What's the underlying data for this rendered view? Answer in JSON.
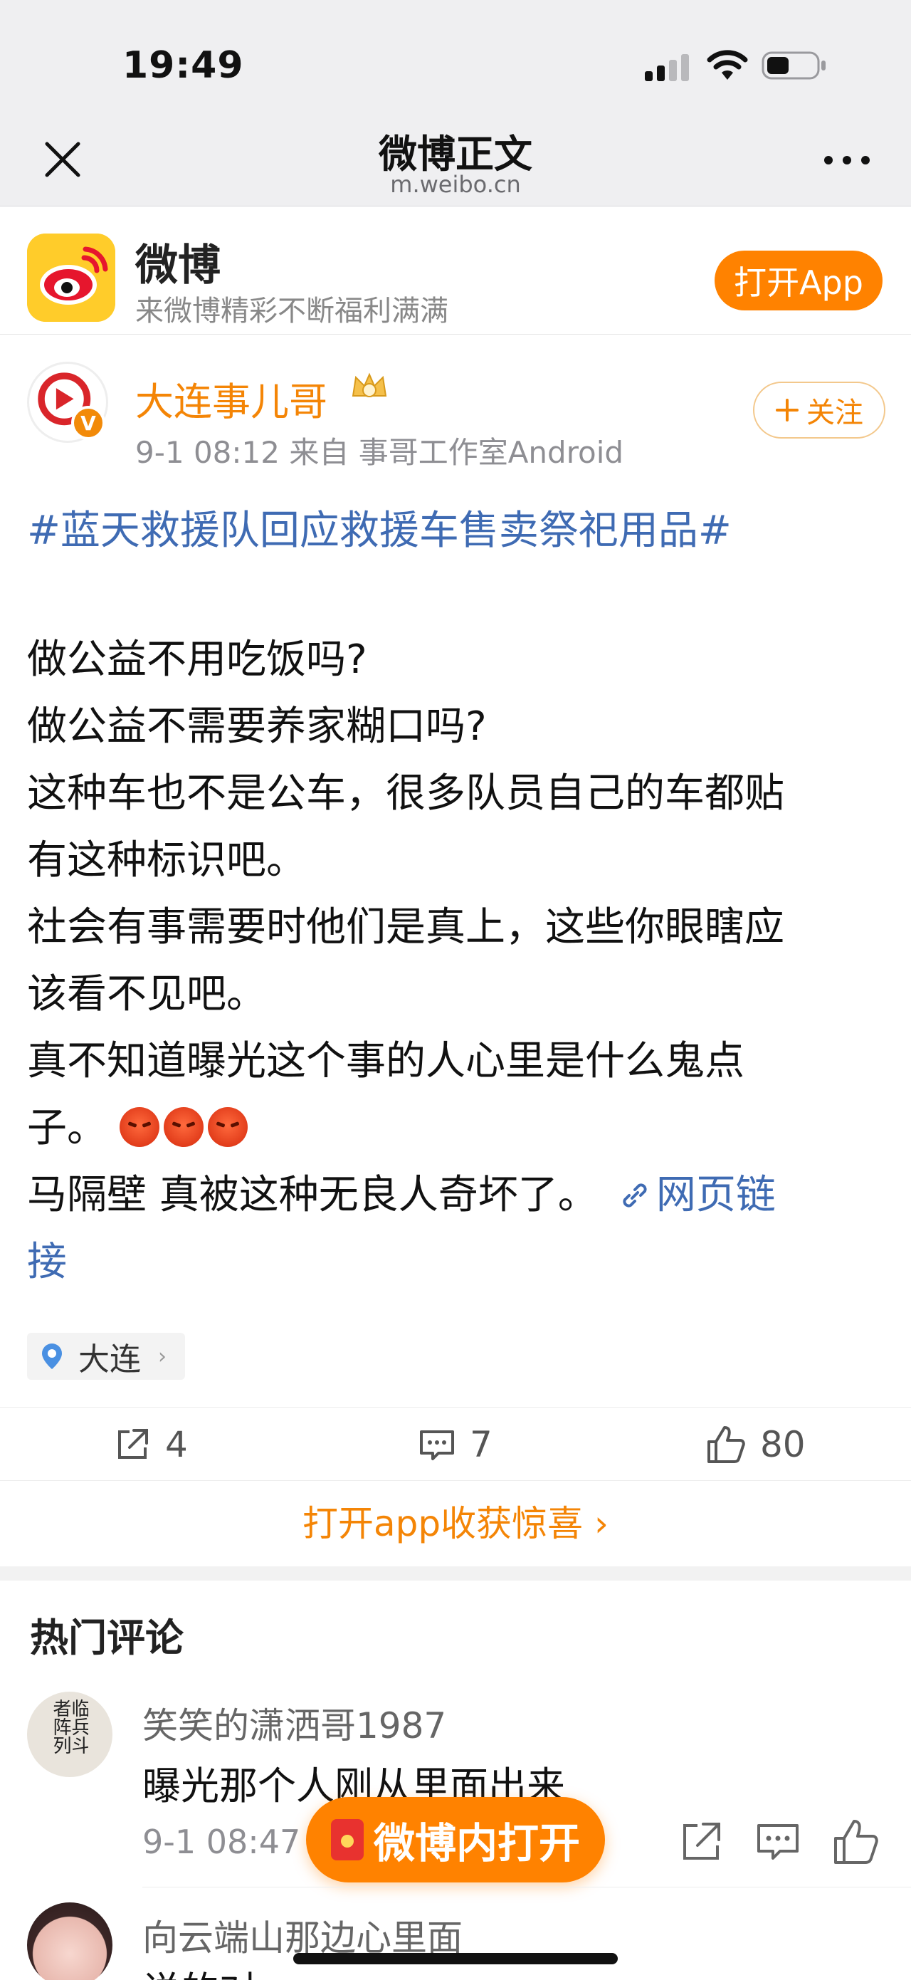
{
  "status_bar": {
    "time": "19:49"
  },
  "browser": {
    "title": "微博正文",
    "url": "m.weibo.cn"
  },
  "app_banner": {
    "name": "微博",
    "slogan": "来微博精彩不断福利满满",
    "open_button": "打开App"
  },
  "post": {
    "author": "大连事儿哥",
    "meta": "9-1 08:12  来自 事哥工作室Android",
    "follow_label": "关注",
    "hashtag": "#蓝天救援队回应救援车售卖祭祀用品#",
    "lines": [
      "做公益不用吃饭吗?",
      "做公益不需要养家糊口吗?",
      "这种车也不是公车，很多队员自己的车都贴",
      "有这种标识吧。",
      "社会有事需要时他们是真上，这些你眼瞎应",
      "该看不见吧。",
      "真不知道曝光这个事的人心里是什么鬼点"
    ],
    "line_zi": "子。",
    "line_last_prefix": "马隔壁 真被这种无良人奇坏了。",
    "link_part1": "网页链",
    "link_part2": "接",
    "location": "大连",
    "reposts": "4",
    "comments": "7",
    "likes": "80"
  },
  "open_app_link": "打开app收获惊喜 ›",
  "hot_comments": {
    "title": "热门评论",
    "items": [
      {
        "avatar_text": "临兵斗者阵列",
        "name": "笑笑的潇洒哥1987",
        "text": "曝光那个人刚从里面出来",
        "meta": "9-1 08:47"
      },
      {
        "name": "向云端山那边心里面",
        "text": "说的对"
      }
    ]
  },
  "floating_button": "微博内打开",
  "colors": {
    "accent": "#ff8200",
    "link": "#3f6bb3",
    "author": "#f48506"
  }
}
